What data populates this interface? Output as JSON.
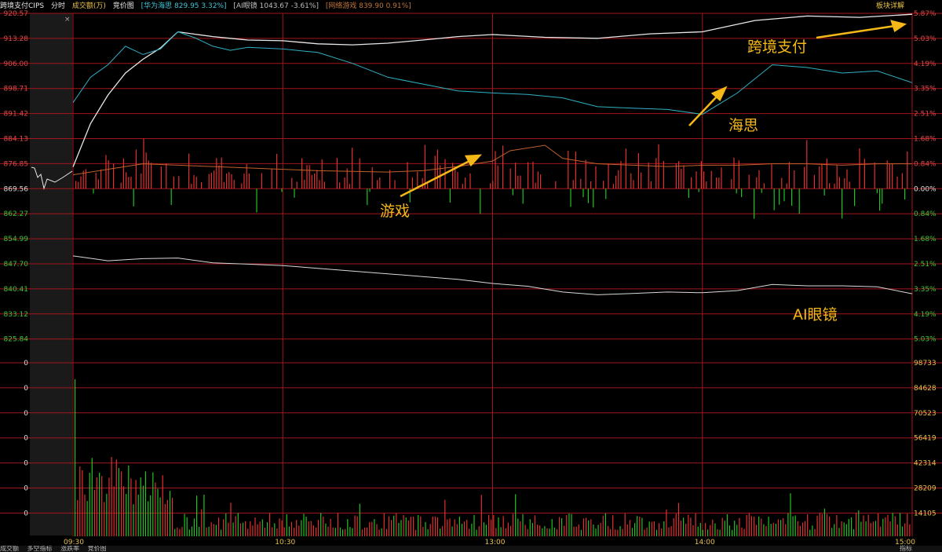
{
  "header": {
    "index_name": "跨境支付CIPS",
    "tab_time": "分时",
    "volume_label": "成交额(万)",
    "auction_label": "竞价图",
    "legend_haisi": "[华为海思 829.95 3.32%]",
    "legend_ai": "[AI眼镜 1043.67 -3.61%]",
    "legend_game": "[网络游戏 839.90 0.91%]",
    "detail_button": "板块详解"
  },
  "footer": {
    "tabs": [
      "成交额",
      "多空指标",
      "涨跌率",
      "竞价图"
    ],
    "right_label": "指标"
  },
  "annotations": {
    "cips": "跨境支付",
    "haisi": "海思",
    "game": "游戏",
    "ai": "AI眼镜"
  },
  "colors": {
    "background": "#000000",
    "grid": "#a3161c",
    "price_axis": "#e04a4a",
    "down": "#21c321",
    "up": "#e03030",
    "cips_line": "#e8e8e8",
    "haisi_line": "#2fb1c4",
    "game_line": "#c0602a",
    "ai_line": "#d8d8d8",
    "annotation": "#f5b817",
    "auction_panel": "#1b1b1b"
  },
  "chart_data": {
    "type": "line",
    "title": "跨境支付CIPS",
    "x_tick_labels": [
      "09:30",
      "10:30",
      "13:00",
      "14:00",
      "15:00"
    ],
    "y_left_labels": [
      "920.57",
      "913.28",
      "906.00",
      "898.71",
      "891.42",
      "884.13",
      "876.85",
      "869.56",
      "862.27",
      "854.99",
      "847.70",
      "840.41",
      "833.12",
      "825.84"
    ],
    "y_right_labels": [
      "5.87%",
      "5.03%",
      "4.19%",
      "3.35%",
      "2.51%",
      "1.68%",
      "0.84%",
      "0.00%",
      "0.84%",
      "1.68%",
      "2.51%",
      "3.35%",
      "4.19%",
      "5.03%"
    ],
    "volume_left_labels": [
      "0",
      "0",
      "0",
      "0",
      "0",
      "0",
      "0"
    ],
    "volume_right_labels": [
      "98733",
      "84628",
      "70523",
      "56419",
      "42314",
      "28209",
      "14105"
    ],
    "prev_close": 869.56,
    "ylim": [
      825.84,
      920.57
    ],
    "series": [
      {
        "name": "跨境支付CIPS",
        "x": [
          0,
          5,
          10,
          15,
          20,
          25,
          30,
          35,
          40,
          45,
          50,
          60,
          70,
          80,
          90,
          100,
          110,
          120,
          135,
          150,
          165,
          180,
          195,
          210,
          225,
          240
        ],
        "values": [
          875.9,
          888.5,
          896.8,
          903.2,
          907.2,
          910.5,
          915.2,
          914.5,
          913.8,
          913.3,
          912.8,
          912.6,
          911.7,
          911.4,
          911.9,
          912.8,
          913.8,
          914.4,
          913.6,
          913.3,
          914.6,
          915.2,
          918.5,
          919.8,
          919.4,
          920.3
        ]
      },
      {
        "name": "华为海思",
        "x": [
          0,
          5,
          10,
          15,
          20,
          25,
          30,
          35,
          40,
          45,
          50,
          60,
          70,
          80,
          90,
          100,
          110,
          120,
          130,
          140,
          150,
          160,
          170,
          180,
          190,
          200,
          210,
          220,
          230,
          240
        ],
        "values": [
          894.6,
          902.0,
          905.6,
          911.0,
          908.6,
          910.2,
          915.2,
          913.4,
          911.0,
          909.8,
          910.7,
          910.2,
          909.2,
          906.0,
          902.0,
          900.0,
          898.0,
          897.4,
          897.0,
          896.0,
          893.4,
          893.0,
          892.6,
          891.2,
          897.4,
          905.6,
          904.8,
          903.2,
          903.8,
          900.4
        ]
      },
      {
        "name": "网络游戏",
        "x": [
          0,
          10,
          20,
          30,
          40,
          50,
          60,
          70,
          80,
          90,
          100,
          110,
          120,
          125,
          130,
          135,
          140,
          150,
          160,
          170,
          180,
          190,
          200,
          210,
          220,
          230,
          240
        ],
        "values": [
          873.6,
          875.2,
          876.8,
          876.4,
          876.0,
          875.6,
          875.2,
          874.8,
          874.6,
          874.4,
          874.8,
          876.0,
          877.6,
          880.6,
          881.4,
          882.2,
          878.4,
          876.8,
          876.4,
          876.0,
          876.4,
          876.4,
          876.8,
          876.8,
          876.4,
          876.8,
          876.8
        ]
      },
      {
        "name": "AI眼镜",
        "x": [
          0,
          10,
          20,
          30,
          40,
          50,
          60,
          70,
          80,
          90,
          100,
          110,
          120,
          130,
          140,
          150,
          160,
          170,
          180,
          190,
          200,
          210,
          220,
          230,
          240
        ],
        "values": [
          850.0,
          848.6,
          849.2,
          849.4,
          848.0,
          847.6,
          847.2,
          846.4,
          845.6,
          844.8,
          844.0,
          843.2,
          842.0,
          841.2,
          839.5,
          838.7,
          839.1,
          839.5,
          839.3,
          839.9,
          841.7,
          841.3,
          841.3,
          841.0,
          839.0
        ]
      }
    ]
  }
}
